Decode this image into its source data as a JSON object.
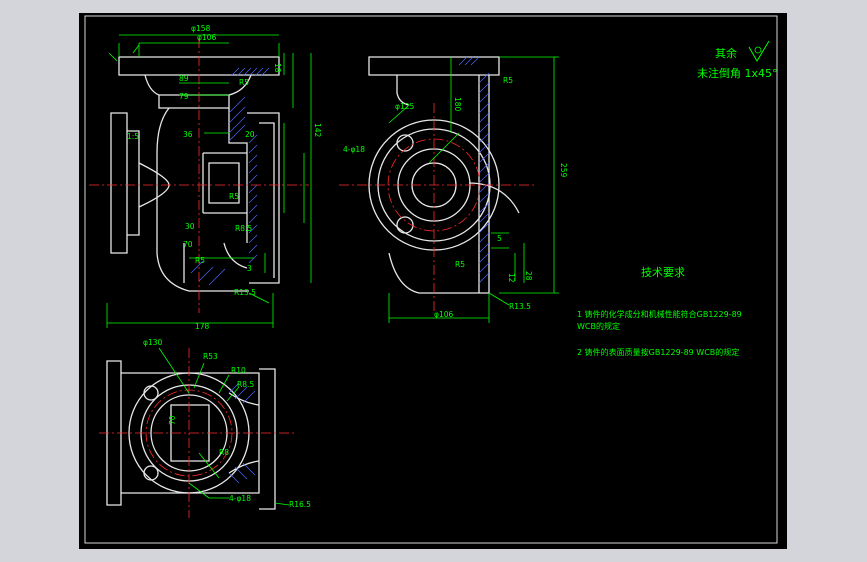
{
  "notes": {
    "surface_finish": "其余",
    "chamfer": "未注倒角 1x45°",
    "heading": "技术要求",
    "requirements": [
      "1 铸件的化学成分和机械性能符合GB1229-89",
      "WCB的规定",
      "2 铸件的表面质量按GB1229-89 WCB的规定"
    ]
  },
  "dims": {
    "d158": "φ158",
    "d106a": "φ106",
    "d125": "φ125",
    "d106b": "φ106",
    "d130": "φ130",
    "len178": "178",
    "h142": "142",
    "h259": "259",
    "h180": "180",
    "r5a": "R5",
    "r5b": "R5",
    "r5c": "R5",
    "r13a": "R13.5",
    "r13b": "R13.5",
    "r53": "R53",
    "r10": "R10",
    "r85a": "R8.5",
    "r8": "R8",
    "r16": "R16.5",
    "holes_a": "4-φ18",
    "holes_b": "4-φ18",
    "v89": "89",
    "v79": "79",
    "v36": "36",
    "v20": "20",
    "v30": "30",
    "v70": "70",
    "v1": "1:5",
    "v3": "3",
    "v18": "18",
    "v28": "28",
    "v12": "12",
    "v5": "5"
  }
}
